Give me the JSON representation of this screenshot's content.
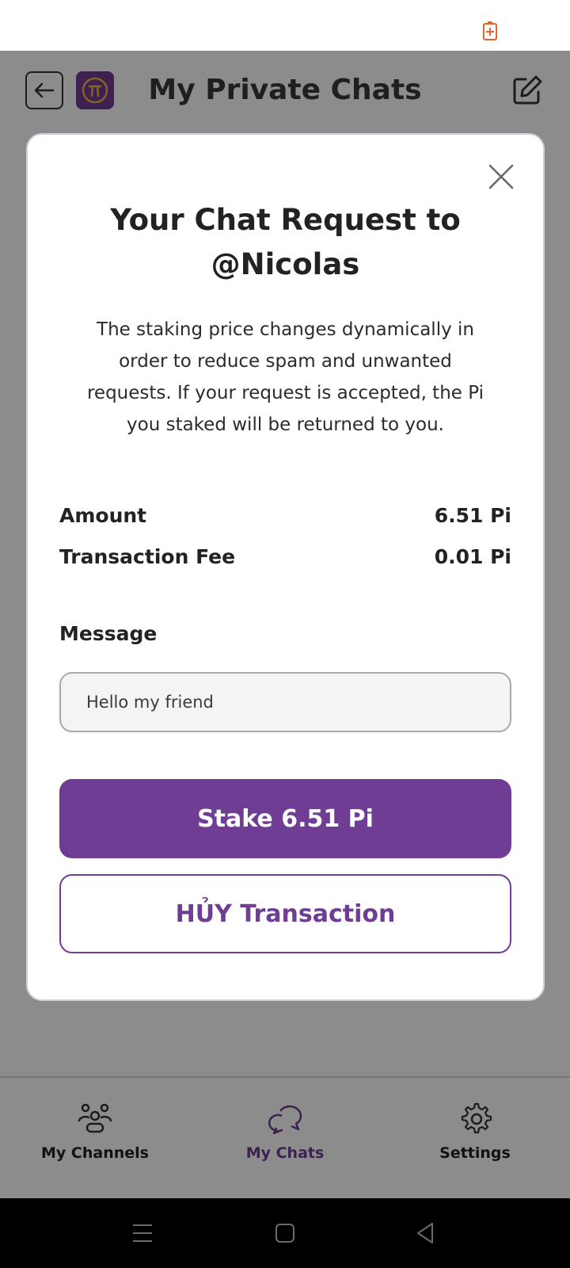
{
  "header": {
    "title": "My Private Chats"
  },
  "modal": {
    "title_line1": "Your Chat Request to",
    "title_line2": "@Nicolas",
    "description": "The staking price changes dynamically in order to reduce spam and unwanted requests. If your request is accepted, the Pi you staked will be returned to you.",
    "amount_label": "Amount",
    "amount_value": "6.51 Pi",
    "fee_label": "Transaction Fee",
    "fee_value": "0.01 Pi",
    "message_label": "Message",
    "message_value": "Hello my friend",
    "stake_button": "Stake 6.51 Pi",
    "cancel_button": "HỦY Transaction"
  },
  "nav": {
    "items": [
      {
        "label": "My Channels",
        "icon": "channels-icon"
      },
      {
        "label": "My Chats",
        "icon": "chats-icon"
      },
      {
        "label": "Settings",
        "icon": "gear-icon"
      }
    ],
    "active": "My Chats"
  },
  "colors": {
    "brand": "#6f3d93",
    "overlay": "rgba(0,0,0,0.45)",
    "battery_accent": "#e8622a"
  }
}
